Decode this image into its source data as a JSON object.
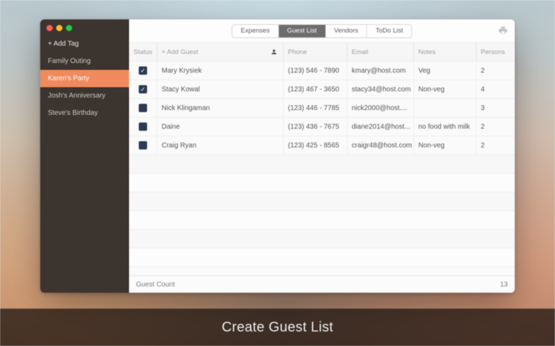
{
  "caption": "Create Guest List",
  "sidebar": {
    "add_label": "+ Add Tag",
    "items": [
      {
        "label": "Family Outing",
        "active": false
      },
      {
        "label": "Karen's Party",
        "active": true
      },
      {
        "label": "Josh's Anniversary",
        "active": false
      },
      {
        "label": "Steve's Birthday",
        "active": false
      }
    ]
  },
  "tabs": {
    "items": [
      {
        "label": "Expenses",
        "active": false
      },
      {
        "label": "Guest List",
        "active": true
      },
      {
        "label": "Vendors",
        "active": false
      },
      {
        "label": "ToDo List",
        "active": false
      }
    ]
  },
  "columns": {
    "status": "Status",
    "name": "+ Add Guest",
    "phone": "Phone",
    "email": "Email",
    "notes": "Notes",
    "persons": "Persons"
  },
  "guests": [
    {
      "checked": true,
      "name": "Mary Krysiek",
      "phone": "(123) 546 - 7890",
      "email": "kmary@host.com",
      "notes": "Veg",
      "persons": 2
    },
    {
      "checked": true,
      "name": "Stacy Kowal",
      "phone": "(123) 467 - 3650",
      "email": "stacy34@host.com",
      "notes": "Non-veg",
      "persons": 4
    },
    {
      "checked": false,
      "name": "Nick Klingaman",
      "phone": "(123) 446 - 7785",
      "email": "nick2000@host....",
      "notes": "",
      "persons": 3
    },
    {
      "checked": false,
      "name": "Daine",
      "phone": "(123) 436 - 7675",
      "email": "diane2014@host...",
      "notes": "no food with milk",
      "persons": 2
    },
    {
      "checked": false,
      "name": "Craig Ryan",
      "phone": "(123) 425 - 8565",
      "email": "craigr48@host.com",
      "notes": "Non-veg",
      "persons": 2
    }
  ],
  "footer": {
    "label": "Guest Count",
    "total": 13
  }
}
